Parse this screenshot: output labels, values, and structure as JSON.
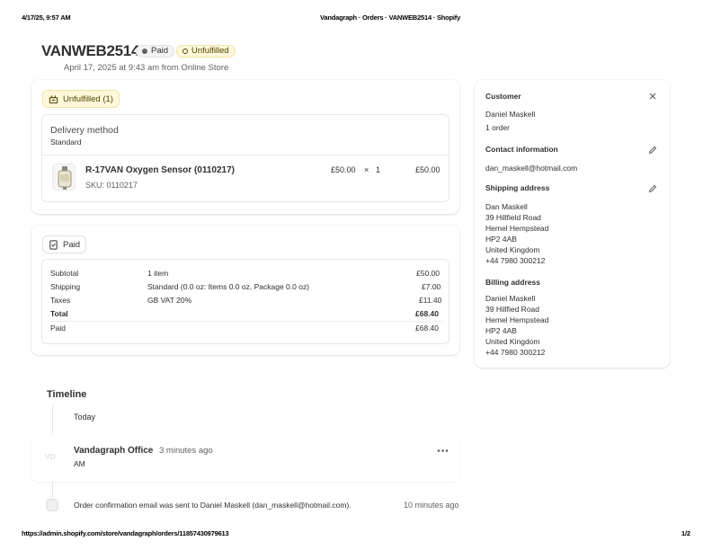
{
  "print": {
    "datetime": "4/17/25, 9:57 AM",
    "title": "Vandagraph · Orders · VANWEB2514 · Shopify",
    "url": "https://admin.shopify.com/store/vandagraph/orders/11857430979613",
    "page": "1/2"
  },
  "order": {
    "name": "VANWEB2514",
    "payment_badge": "Paid",
    "fulfillment_badge": "Unfulfilled",
    "subtitle": "April 17, 2025 at 9:43 am from Online Store"
  },
  "fulfillment": {
    "status_label": "Unfulfilled (1)",
    "delivery_heading": "Delivery method",
    "delivery_value": "Standard",
    "item": {
      "title": "R-17VAN Oxygen Sensor (0110217)",
      "sku": "SKU: 0110217",
      "price": "£50.00",
      "times": "×",
      "qty": "1",
      "total": "£50.00"
    }
  },
  "payment": {
    "status_label": "Paid",
    "rows": [
      {
        "label": "Subtotal",
        "detail": "1 item",
        "amount": "£50.00"
      },
      {
        "label": "Shipping",
        "detail": "Standard (0.0 oz: Items 0.0 oz, Package 0.0 oz)",
        "amount": "£7.00"
      },
      {
        "label": "Taxes",
        "detail": "GB VAT 20%",
        "amount": "£11.40"
      },
      {
        "label": "Total",
        "detail": "",
        "amount": "£68.40"
      },
      {
        "label": "Paid",
        "detail": "",
        "amount": "£68.40"
      }
    ]
  },
  "timeline": {
    "heading": "Timeline",
    "day": "Today",
    "comment_author": "Vandagraph Office",
    "comment_time": "3 minutes ago",
    "comment_sub": "AM",
    "avatar_initials": "VO",
    "event_text": "Order confirmation email was sent to Daniel Maskell (dan_maskell@hotmail.com).",
    "event_time": "10 minutes ago"
  },
  "customer": {
    "heading": "Customer",
    "name": "Daniel Maskell",
    "orders": "1 order",
    "contact_heading": "Contact information",
    "email": "dan_maskell@hotmail.com",
    "shipping_heading": "Shipping address",
    "shipping": [
      "Dan Maskell",
      "39 Hillfield Road",
      "Hemel Hempstead",
      "HP2 4AB",
      "United Kingdom",
      "+44 7980 300212"
    ],
    "billing_heading": "Billing address",
    "billing": [
      "Daniel Maskell",
      "39 Hillfied Road",
      "Hemel Hempstead",
      "HP2 4AB",
      "United Kingdom",
      "+44 7980 300212"
    ]
  },
  "icons": {
    "close": "close-icon",
    "edit": "pencil-icon",
    "more": "more-horizontal-icon"
  },
  "colors": {
    "unfulfilled_bg": "#fff8db",
    "unfulfilled_text": "#4f4700",
    "text": "#303030",
    "muted": "#616161"
  }
}
